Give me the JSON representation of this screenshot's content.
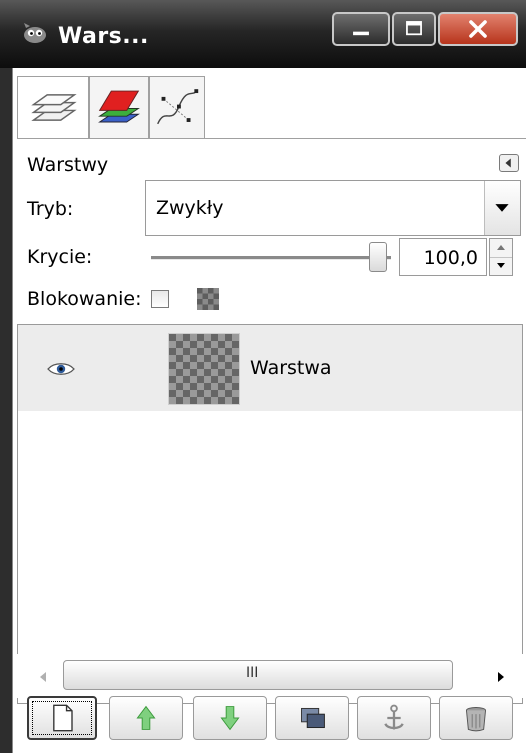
{
  "window": {
    "title": "Wars...",
    "controls": [
      "minimize",
      "maximize",
      "close"
    ]
  },
  "tabs": [
    {
      "name": "layers-tab",
      "icon": "layers-icon",
      "active": true
    },
    {
      "name": "channels-tab",
      "icon": "channels-icon",
      "active": false
    },
    {
      "name": "paths-tab",
      "icon": "paths-icon",
      "active": false
    }
  ],
  "panel": {
    "title": "Warstwy"
  },
  "mode": {
    "label": "Tryb:",
    "value": "Zwykły"
  },
  "opacity": {
    "label": "Krycie:",
    "value": "100,0",
    "fraction": 1.0
  },
  "lock": {
    "label": "Blokowanie:",
    "checked": false
  },
  "layers": [
    {
      "name": "Warstwa",
      "visible": true
    }
  ],
  "scrollbar": {
    "grip": "III"
  },
  "toolbar": {
    "buttons": [
      "new-layer-icon",
      "raise-layer-icon",
      "lower-layer-icon",
      "duplicate-layer-icon",
      "anchor-layer-icon",
      "delete-layer-icon"
    ]
  },
  "colors": {
    "titlebar": "#1a1a1a",
    "close_button": "#c8452a",
    "arrow_green": "#4caf50",
    "row_selected": "#ececec"
  }
}
